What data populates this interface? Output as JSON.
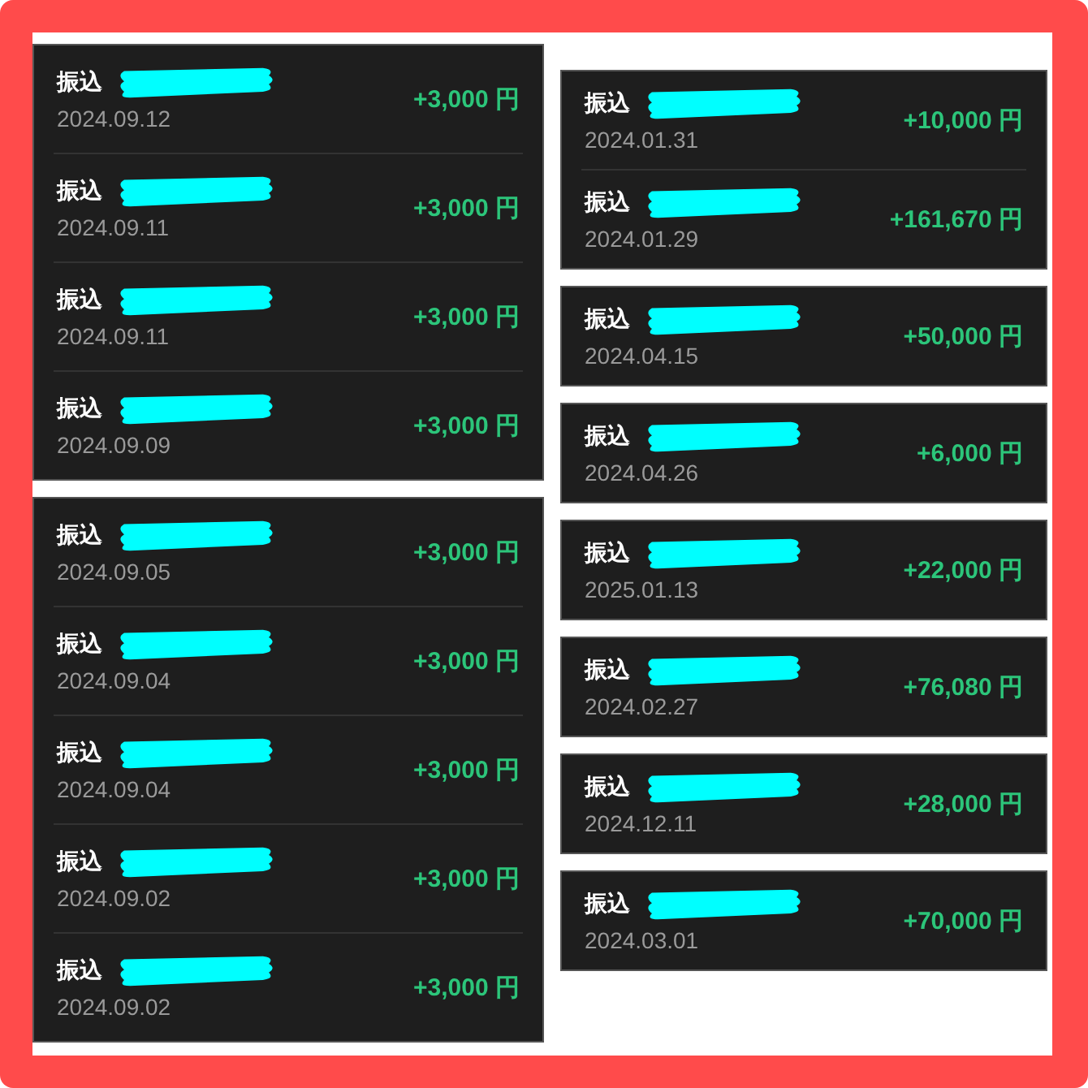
{
  "columns": [
    {
      "cards": [
        {
          "rows": [
            {
              "label": "振込",
              "date": "2024.09.12",
              "amount": "+3,000 円"
            },
            {
              "label": "振込",
              "date": "2024.09.11",
              "amount": "+3,000 円"
            },
            {
              "label": "振込",
              "date": "2024.09.11",
              "amount": "+3,000 円"
            },
            {
              "label": "振込",
              "date": "2024.09.09",
              "amount": "+3,000 円"
            }
          ]
        },
        {
          "rows": [
            {
              "label": "振込",
              "date": "2024.09.05",
              "amount": "+3,000 円"
            },
            {
              "label": "振込",
              "date": "2024.09.04",
              "amount": "+3,000 円"
            },
            {
              "label": "振込",
              "date": "2024.09.04",
              "amount": "+3,000 円"
            },
            {
              "label": "振込",
              "date": "2024.09.02",
              "amount": "+3,000 円"
            },
            {
              "label": "振込",
              "date": "2024.09.02",
              "amount": "+3,000 円"
            }
          ]
        }
      ]
    },
    {
      "cards": [
        {
          "rows": [
            {
              "label": "振込",
              "date": "2024.01.31",
              "amount": "+10,000 円"
            },
            {
              "label": "振込",
              "date": "2024.01.29",
              "amount": "+161,670 円"
            }
          ]
        },
        {
          "rows": [
            {
              "label": "振込",
              "date": "2024.04.15",
              "amount": "+50,000 円"
            }
          ]
        },
        {
          "rows": [
            {
              "label": "振込",
              "date": "2024.04.26",
              "amount": "+6,000 円"
            }
          ]
        },
        {
          "rows": [
            {
              "label": "振込",
              "date": "2025.01.13",
              "amount": "+22,000 円"
            }
          ]
        },
        {
          "rows": [
            {
              "label": "振込",
              "date": "2024.02.27",
              "amount": "+76,080 円"
            }
          ]
        },
        {
          "rows": [
            {
              "label": "振込",
              "date": "2024.12.11",
              "amount": "+28,000 円"
            }
          ]
        },
        {
          "rows": [
            {
              "label": "振込",
              "date": "2024.03.01",
              "amount": "+70,000 円"
            }
          ]
        }
      ]
    }
  ]
}
